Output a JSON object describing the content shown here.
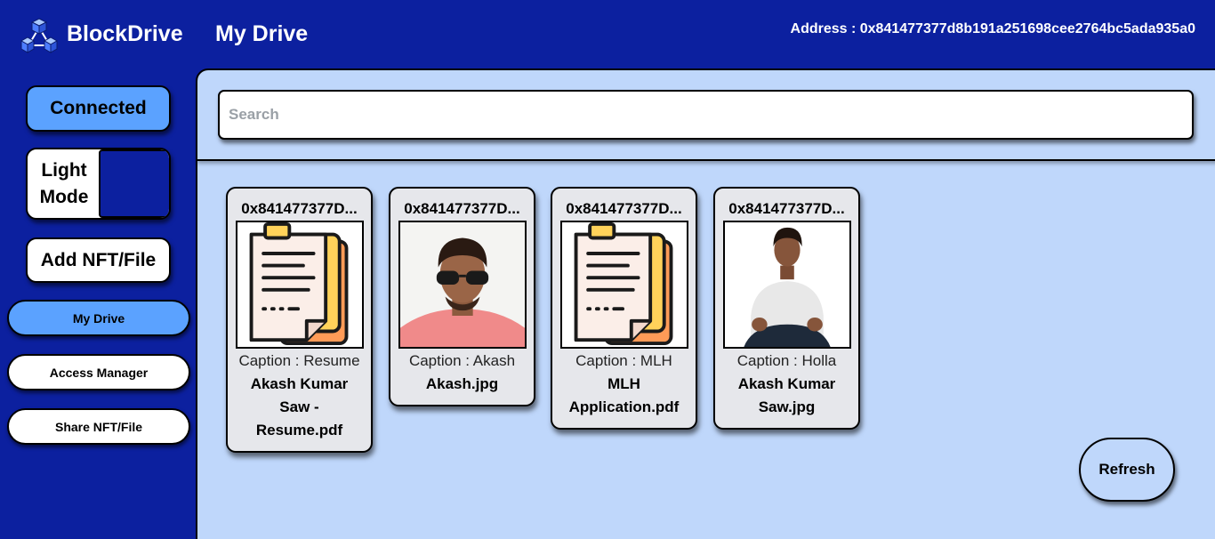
{
  "header": {
    "brand": "BlockDrive",
    "page_title": "My Drive",
    "address_label": "Address : 0x841477377d8b191a251698cee2764bc5ada935a0",
    "logo_icon": "blockchain-cubes-icon"
  },
  "sidebar": {
    "connect_label": "Connected",
    "theme_label": "Light Mode",
    "add_label": "Add NFT/File",
    "nav": [
      {
        "label": "My Drive",
        "active": true
      },
      {
        "label": "Access Manager",
        "active": false
      },
      {
        "label": "Share NFT/File",
        "active": false
      }
    ]
  },
  "search": {
    "placeholder": "Search",
    "value": ""
  },
  "files": [
    {
      "owner": "0x841477377D...",
      "thumbnail": "document-icon",
      "caption": "Caption : Resume",
      "name": "Akash Kumar Saw - Resume.pdf"
    },
    {
      "owner": "0x841477377D...",
      "thumbnail": "photo-portrait",
      "caption": "Caption : Akash",
      "name": "Akash.jpg"
    },
    {
      "owner": "0x841477377D...",
      "thumbnail": "document-icon",
      "caption": "Caption : MLH",
      "name": "MLH Application.pdf"
    },
    {
      "owner": "0x841477377D...",
      "thumbnail": "photo-portrait",
      "caption": "Caption : Holla",
      "name": "Akash Kumar Saw.jpg"
    }
  ],
  "refresh_label": "Refresh",
  "colors": {
    "background": "#0c209f",
    "panel": "#bfd7fb",
    "accent": "#5ba2ff",
    "card": "#e6e7eb"
  }
}
